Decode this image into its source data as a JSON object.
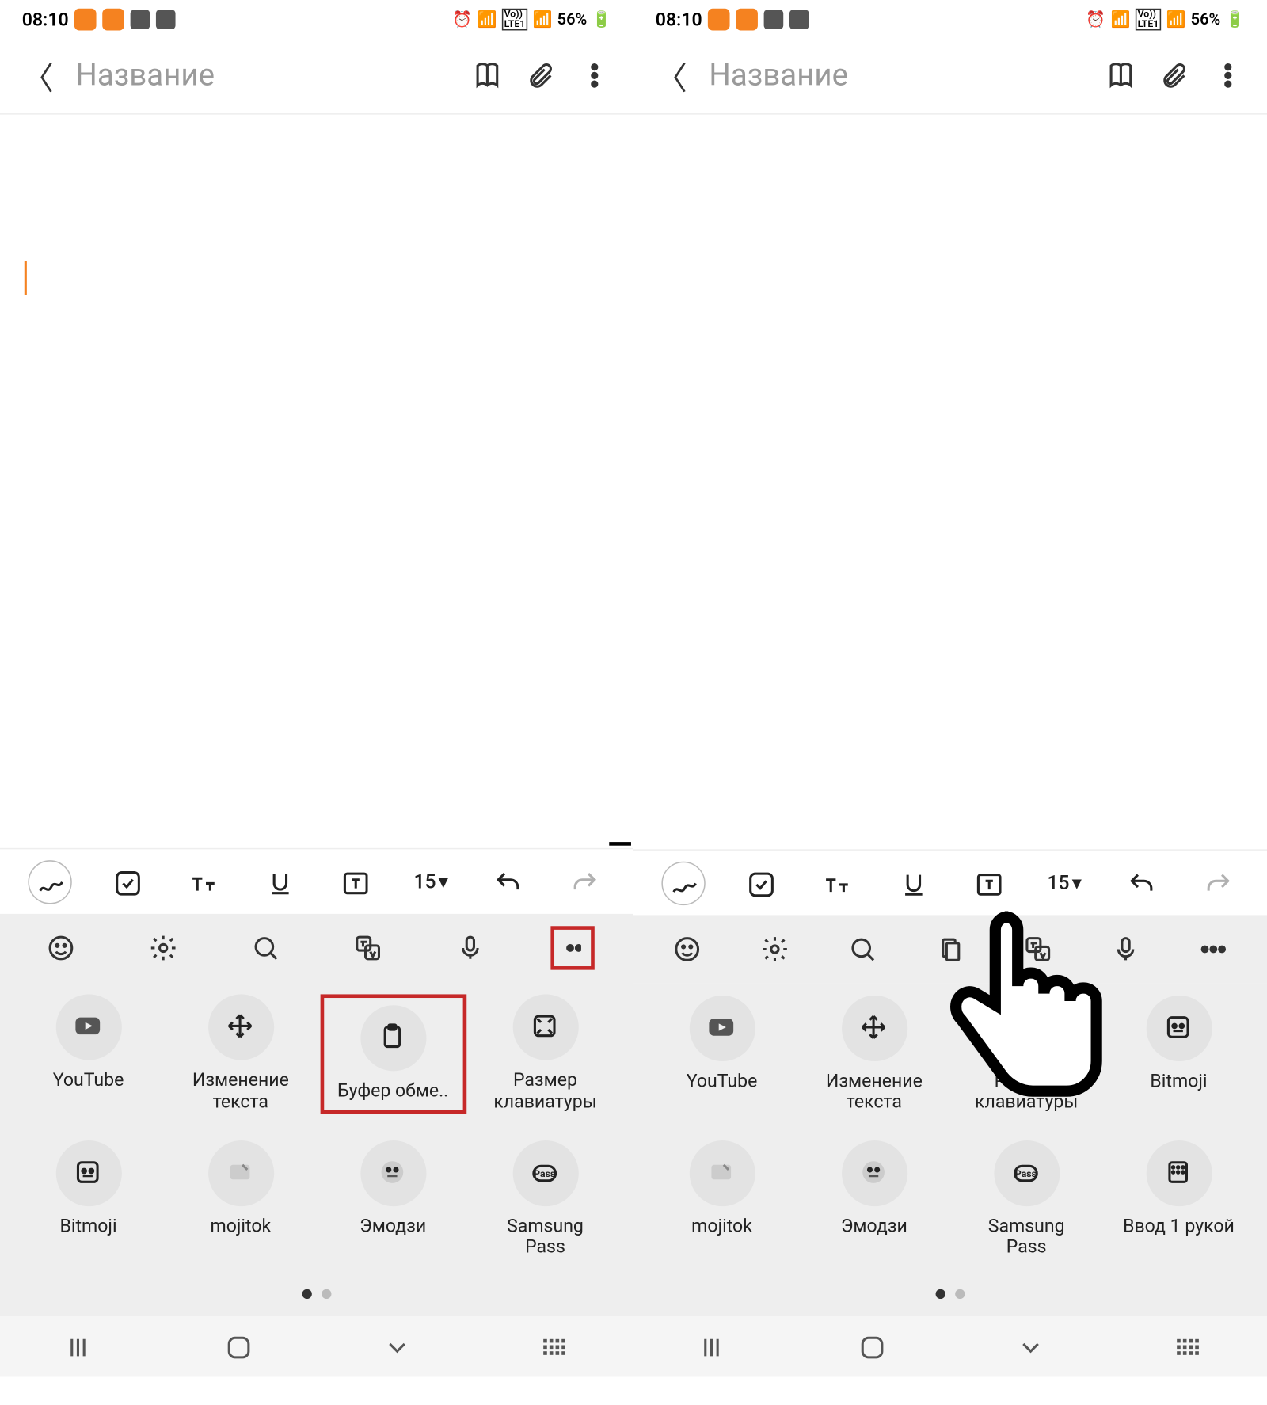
{
  "status": {
    "time": "08:10",
    "battery_percent": "56%"
  },
  "header": {
    "title": "Название"
  },
  "format": {
    "font_size": "15"
  },
  "panel1_items": [
    {
      "id": "youtube",
      "label": "YouTube"
    },
    {
      "id": "edit-text",
      "label": "Изменение\nтекста"
    },
    {
      "id": "clipboard",
      "label": "Буфер обме.."
    },
    {
      "id": "kb-size",
      "label": "Размер\nклавиатуры"
    },
    {
      "id": "bitmoji",
      "label": "Bitmoji"
    },
    {
      "id": "mojitok",
      "label": "mojitok"
    },
    {
      "id": "emoji",
      "label": "Эмодзи"
    },
    {
      "id": "pass",
      "label": "Samsung\nPass"
    }
  ],
  "panel2_items": [
    {
      "id": "youtube",
      "label": "YouTube"
    },
    {
      "id": "edit-text",
      "label": "Изменение\nтекста"
    },
    {
      "id": "kb-size",
      "label": "Размер\nклавиатуры"
    },
    {
      "id": "bitmoji",
      "label": "Bitmoji"
    },
    {
      "id": "mojitok",
      "label": "mojitok"
    },
    {
      "id": "emoji",
      "label": "Эмодзи"
    },
    {
      "id": "pass",
      "label": "Samsung\nPass"
    },
    {
      "id": "one-hand",
      "label": "Ввод 1 рукой"
    }
  ]
}
